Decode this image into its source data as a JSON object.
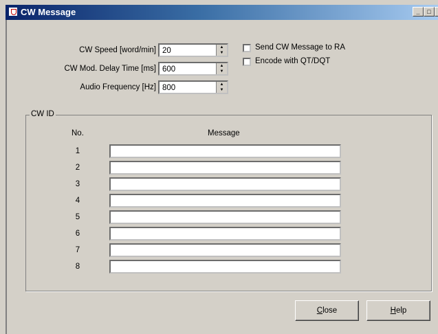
{
  "window": {
    "title": "CW Message",
    "min": "_",
    "max": "□",
    "close": "×"
  },
  "settings": {
    "cw_speed_label": "CW Speed [word/min]",
    "cw_speed_value": "20",
    "delay_label": "CW Mod. Delay Time [ms]",
    "delay_value": "600",
    "audio_label": "Audio Frequency [Hz]",
    "audio_value": "800",
    "send_ra_label": "Send CW Message to RA",
    "encode_label": "Encode with QT/DQT",
    "send_ra_checked": false,
    "encode_checked": false
  },
  "cw_id": {
    "group_title": "CW ID",
    "col_no": "No.",
    "col_message": "Message",
    "rows": [
      {
        "no": "1",
        "message": ""
      },
      {
        "no": "2",
        "message": ""
      },
      {
        "no": "3",
        "message": ""
      },
      {
        "no": "4",
        "message": ""
      },
      {
        "no": "5",
        "message": ""
      },
      {
        "no": "6",
        "message": ""
      },
      {
        "no": "7",
        "message": ""
      },
      {
        "no": "8",
        "message": ""
      }
    ]
  },
  "buttons": {
    "close_first": "C",
    "close_rest": "lose",
    "help_first": "H",
    "help_rest": "elp"
  },
  "icons": {
    "app": "app-icon",
    "spin": "spin-arrows-icon"
  }
}
